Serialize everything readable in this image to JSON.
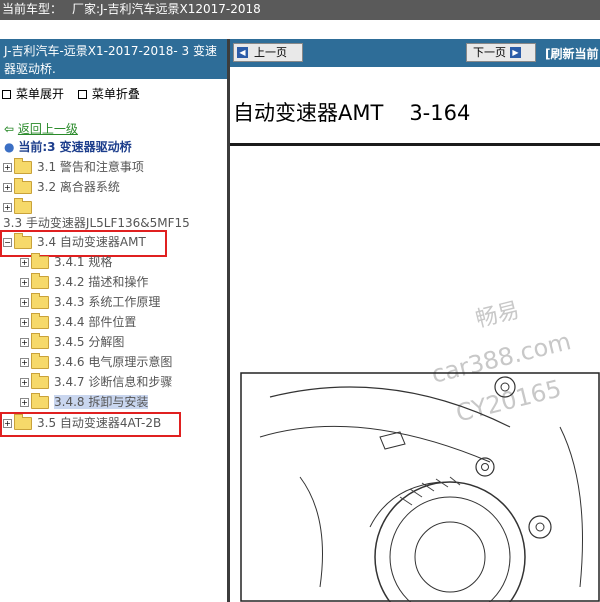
{
  "topbar": {
    "label": "当前车型：",
    "model": "厂家:J-吉利汽车远景X12017-2018"
  },
  "left": {
    "header": "J-吉利汽车-远景X1-2017-2018- 3 变速器驱动桥.",
    "menu_expand": "菜单展开",
    "menu_collapse": "菜单折叠",
    "back": "返回上一级",
    "current": "当前:3 变速器驱动桥",
    "tree": [
      {
        "label": "3.1 警告和注意事项"
      },
      {
        "label": "3.2 离合器系统"
      },
      {
        "label": ""
      },
      {
        "label": "3.3 手动变速器JL5LF136&5MF15"
      },
      {
        "label": "3.4 自动变速器AMT"
      },
      {
        "label": "3.4.1 规格"
      },
      {
        "label": "3.4.2 描述和操作"
      },
      {
        "label": "3.4.3 系统工作原理"
      },
      {
        "label": "3.4.4 部件位置"
      },
      {
        "label": "3.4.5 分解图"
      },
      {
        "label": "3.4.6 电气原理示意图"
      },
      {
        "label": "3.4.7 诊断信息和步骤"
      },
      {
        "label": "3.4.8 拆卸与安装"
      },
      {
        "label": "3.5 自动变速器4AT-2B"
      }
    ]
  },
  "right": {
    "prev": "上一页",
    "next": "下一页",
    "refresh": "[刷新当前",
    "title": "自动变速器AMT",
    "page": "3-164",
    "watermark": [
      "畅易",
      "car388.com",
      "CY20165"
    ]
  },
  "colors": {
    "nav_bg": "#2e6d98",
    "topbar_bg": "#5a5a5a",
    "highlight": "#e02020"
  }
}
